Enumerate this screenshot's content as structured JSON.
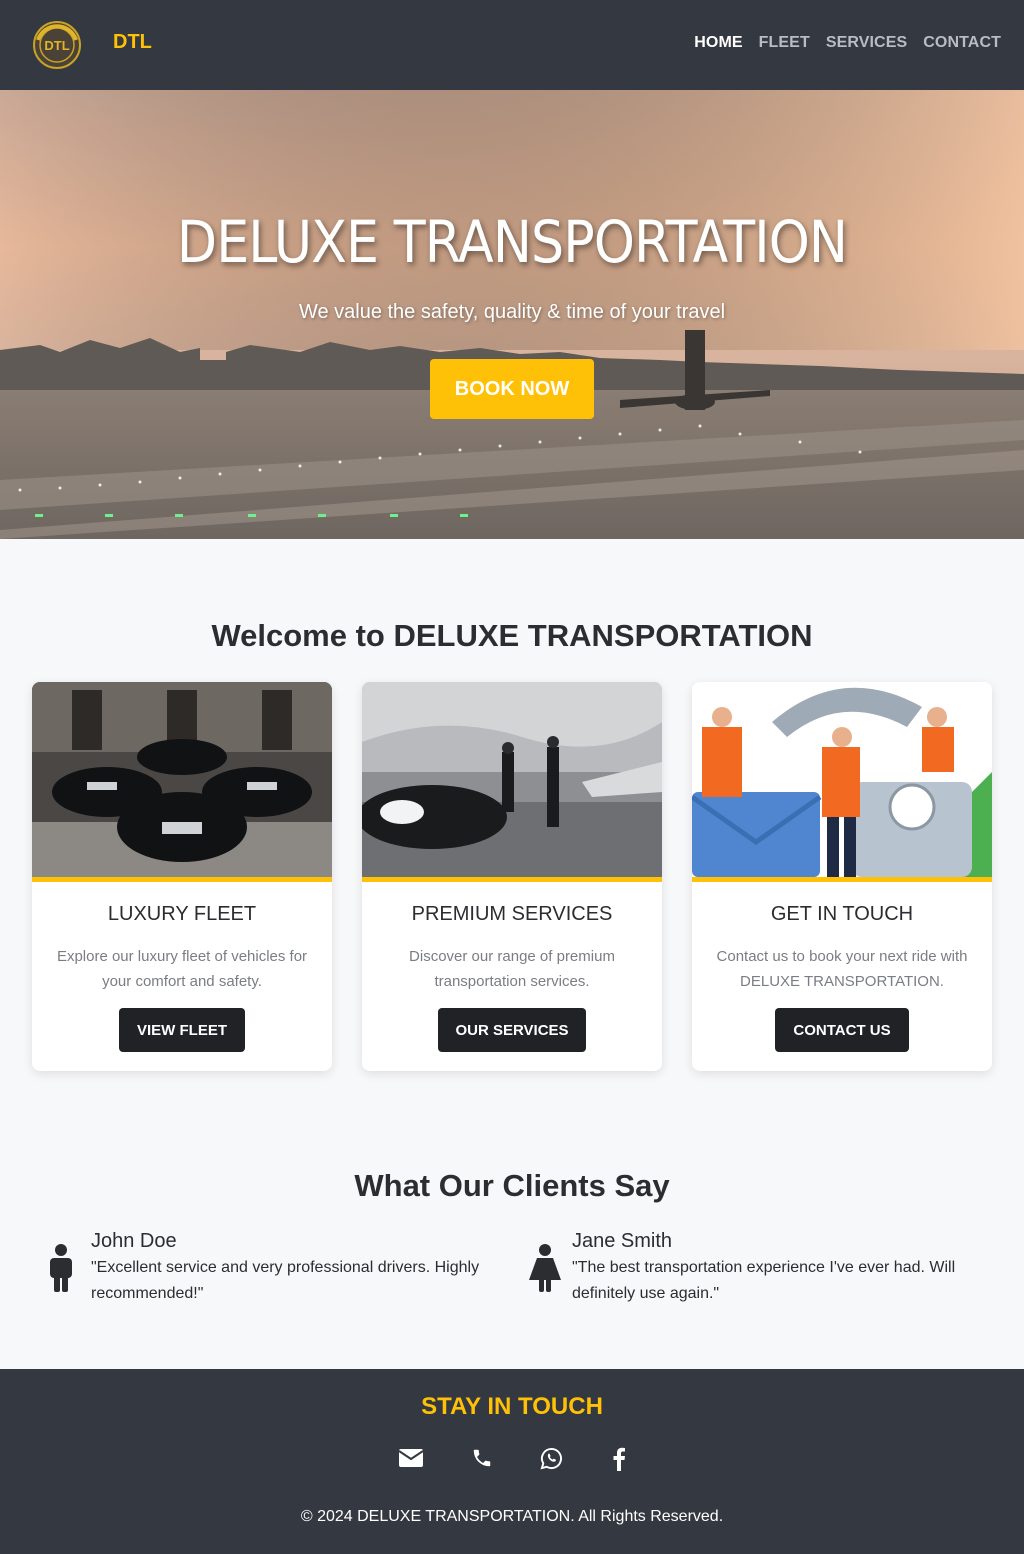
{
  "navbar": {
    "logo_text": "DTL",
    "brand": "DTL",
    "links": [
      {
        "label": "HOME",
        "active": true
      },
      {
        "label": "FLEET",
        "active": false
      },
      {
        "label": "SERVICES",
        "active": false
      },
      {
        "label": "CONTACT",
        "active": false
      }
    ]
  },
  "hero": {
    "title": "DELUXE TRANSPORTATION",
    "subtitle": "We value the safety, quality & time of your travel",
    "button": "BOOK NOW"
  },
  "welcome": {
    "title": "Welcome to DELUXE TRANSPORTATION",
    "cards": [
      {
        "title": "LUXURY FLEET",
        "text": "Explore our luxury fleet of vehicles for your comfort and safety.",
        "button": "VIEW FLEET"
      },
      {
        "title": "PREMIUM SERVICES",
        "text": "Discover our range of premium transportation services.",
        "button": "OUR SERVICES"
      },
      {
        "title": "GET IN TOUCH",
        "text": "Contact us to book your next ride with DELUXE TRANSPORTATION.",
        "button": "CONTACT US"
      }
    ]
  },
  "testimonials": {
    "title": "What Our Clients Say",
    "items": [
      {
        "name": "John Doe",
        "quote": "\"Excellent service and very professional drivers. Highly recommended!\"",
        "icon": "male-user-icon"
      },
      {
        "name": "Jane Smith",
        "quote": "\"The best transportation experience I've ever had. Will definitely use again.\"",
        "icon": "female-user-icon"
      }
    ]
  },
  "footer": {
    "title": "STAY IN TOUCH",
    "social": [
      "envelope-icon",
      "phone-icon",
      "whatsapp-icon",
      "facebook-icon"
    ],
    "copyright": "© 2024 DELUXE TRANSPORTATION. All Rights Reserved."
  },
  "colors": {
    "accent": "#ffc107",
    "navbar_bg": "#343840",
    "button_dark": "#212225",
    "page_bg": "#f7f8f9"
  }
}
